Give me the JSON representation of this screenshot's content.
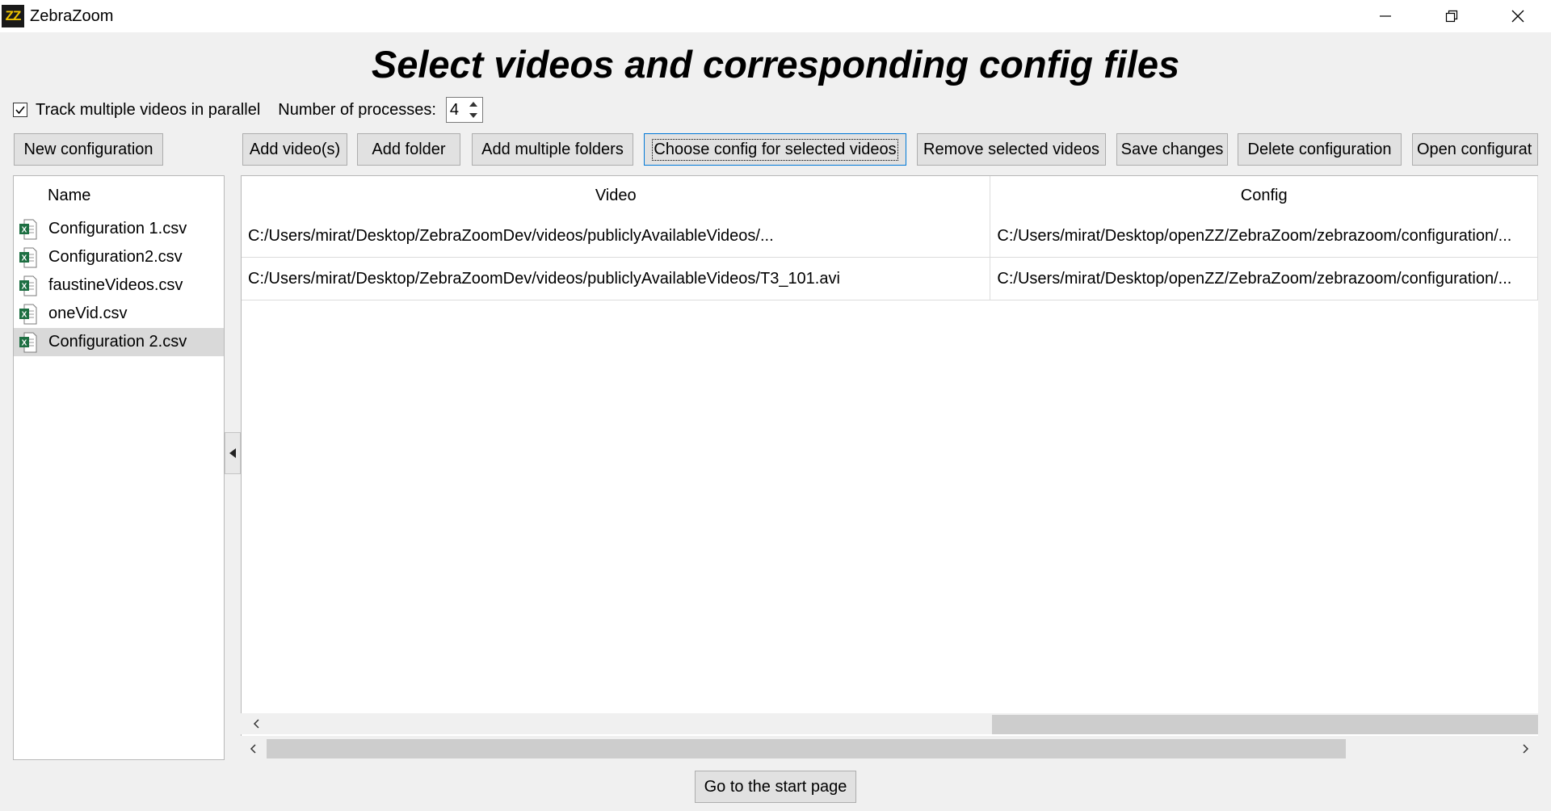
{
  "window": {
    "app_icon_text": "ZZ",
    "title": "ZebraZoom"
  },
  "page": {
    "title": "Select videos and corresponding config files"
  },
  "options": {
    "track_parallel_label": "Track multiple videos in parallel",
    "track_parallel_checked": true,
    "processes_label": "Number of processes:",
    "processes_value": "4"
  },
  "toolbar": {
    "new_configuration": "New configuration",
    "add_videos": "Add video(s)",
    "add_folder": "Add folder",
    "add_multiple_folders": "Add multiple folders",
    "choose_config": "Choose config for selected videos",
    "remove_selected": "Remove selected videos",
    "save_changes": "Save changes",
    "delete_configuration": "Delete configuration",
    "open_configuration": "Open configurat"
  },
  "file_list": {
    "header": "Name",
    "items": [
      {
        "name": "Configuration 1.csv",
        "icon": "excel-csv-icon"
      },
      {
        "name": "Configuration2.csv",
        "icon": "excel-csv-icon"
      },
      {
        "name": "faustineVideos.csv",
        "icon": "excel-csv-icon"
      },
      {
        "name": "oneVid.csv",
        "icon": "excel-csv-icon"
      },
      {
        "name": "Configuration 2.csv",
        "icon": "excel-csv-icon",
        "selected": true
      }
    ]
  },
  "table": {
    "headers": [
      "Video",
      "Config"
    ],
    "rows": [
      [
        "C:/Users/mirat/Desktop/ZebraZoomDev/videos/publiclyAvailableVideos/...",
        "C:/Users/mirat/Desktop/openZZ/ZebraZoom/zebrazoom/configuration/..."
      ],
      [
        "C:/Users/mirat/Desktop/ZebraZoomDev/videos/publiclyAvailableVideos/T3_101.avi",
        "C:/Users/mirat/Desktop/openZZ/ZebraZoom/zebrazoom/configuration/..."
      ]
    ]
  },
  "footer": {
    "start_page": "Go to the start page"
  },
  "colors": {
    "window_bg": "#f0f0f0",
    "button_bg": "#e1e1e1",
    "focus_border": "#0078d7",
    "excel_green": "#1d6f42",
    "selected_row": "#d9d9d9"
  }
}
